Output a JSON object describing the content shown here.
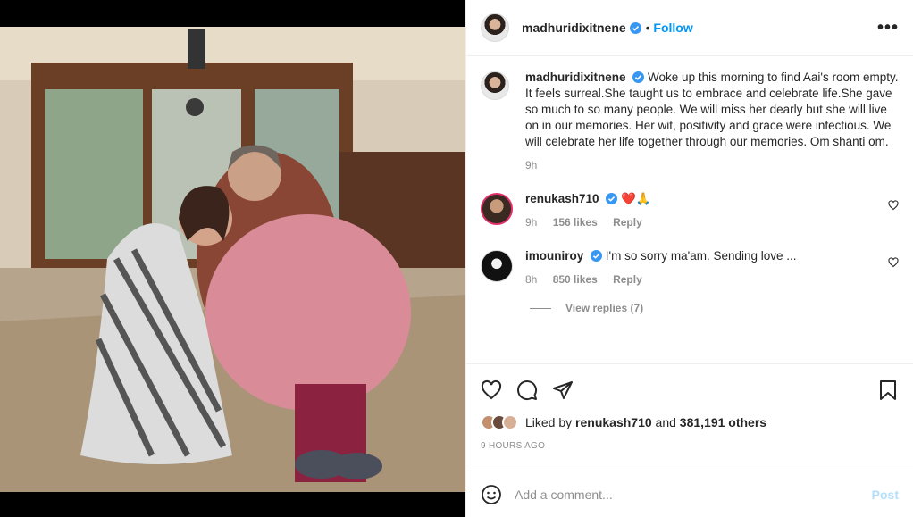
{
  "post": {
    "username": "madhuridixitnene",
    "follow_label": "Follow",
    "dot": "•",
    "more_label": "•••",
    "caption": "Woke up this morning to find Aai's room empty. It feels surreal.She taught us to embrace and celebrate life.She gave so much to so many people. We will miss her dearly but she will live on in our memories. Her wit, positivity and grace were infectious. We will celebrate her life together through our memories. Om shanti om.",
    "caption_time": "9h",
    "comments": [
      {
        "user": "renukash710",
        "text": "❤️🙏",
        "time": "9h",
        "likes": "156 likes",
        "reply": "Reply"
      },
      {
        "user": "imouniroy",
        "text": "I'm so sorry ma'am. Sending love ...",
        "time": "8h",
        "likes": "850 likes",
        "reply": "Reply"
      }
    ],
    "view_replies": "View replies (7)",
    "liked_by_prefix": "Liked by",
    "liked_by_user": "renukash710",
    "liked_by_and": "and",
    "liked_by_others": "381,191 others",
    "timestamp": "9 HOURS AGO",
    "comment_placeholder": "Add a comment...",
    "post_label": "Post"
  },
  "colors": {
    "accent": "#0095f6",
    "verified": "#3897f0",
    "muted": "#8e8e8e",
    "post_disabled": "#b2dffc"
  },
  "icons": [
    "verified-icon",
    "more-icon",
    "heart-icon",
    "comment-icon",
    "share-icon",
    "bookmark-icon",
    "emoji-icon"
  ]
}
